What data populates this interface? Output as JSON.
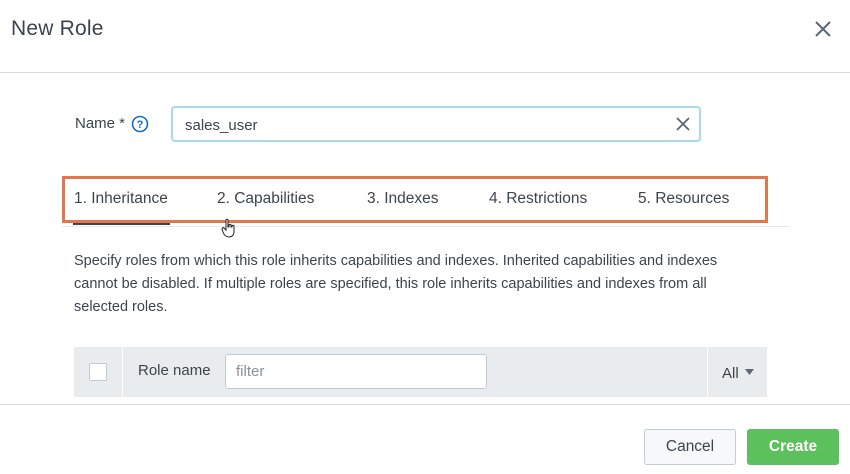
{
  "dialog": {
    "title": "New Role"
  },
  "name_field": {
    "label": "Name *",
    "value": "sales_user"
  },
  "tabs": [
    {
      "label": "1. Inheritance",
      "active": true
    },
    {
      "label": "2. Capabilities",
      "active": false
    },
    {
      "label": "3. Indexes",
      "active": false
    },
    {
      "label": "4. Restrictions",
      "active": false
    },
    {
      "label": "5. Resources",
      "active": false
    }
  ],
  "description": "Specify roles from which this role inherits capabilities and indexes. Inherited capabilities and indexes cannot be disabled. If multiple roles are specified, this role inherits capabilities and indexes from all selected roles.",
  "table": {
    "column_role_name": "Role name",
    "filter_placeholder": "filter",
    "all_label": "All"
  },
  "footer": {
    "cancel_label": "Cancel",
    "create_label": "Create"
  },
  "colors": {
    "highlight": "#e2774d",
    "create_button": "#5cc05c",
    "input_focus": "#a9d7ee",
    "help_icon": "#1a6eb5"
  },
  "icons": [
    "close-icon",
    "help-icon",
    "clear-icon",
    "cursor-icon",
    "caret-down-icon"
  ]
}
